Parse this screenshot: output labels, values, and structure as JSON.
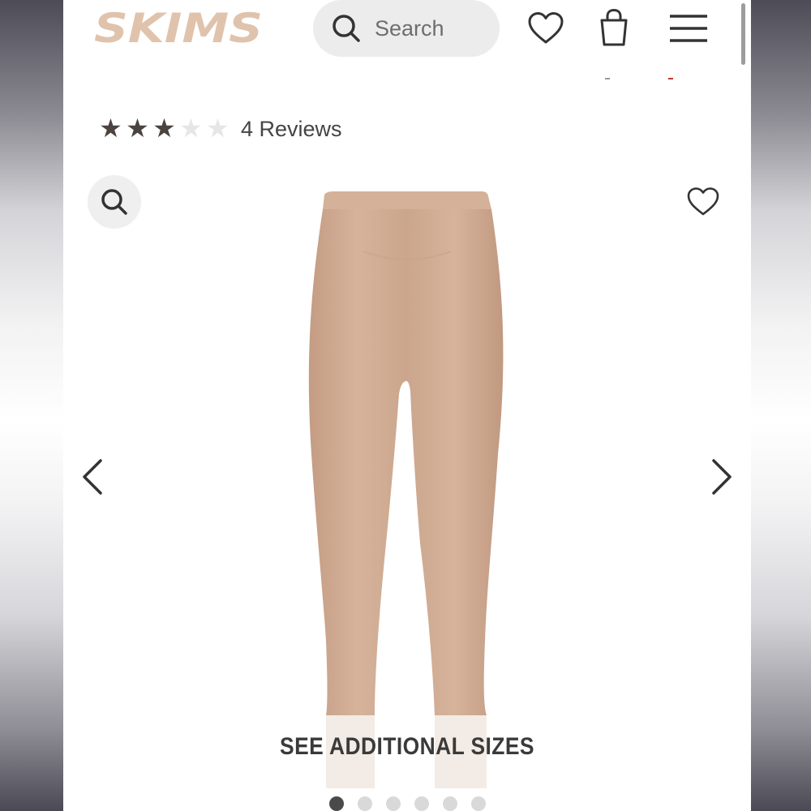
{
  "header": {
    "logo_text": "SKIMS",
    "search_placeholder": "Search",
    "wishlist_icon": "heart-icon",
    "bag_icon": "shopping-bag-icon",
    "menu_icon": "hamburger-menu-icon"
  },
  "rating": {
    "stars_filled": 3,
    "stars_total": 5,
    "reviews_label": "4 Reviews"
  },
  "gallery": {
    "zoom_icon": "magnifier-icon",
    "wishlist_icon": "heart-outline-icon",
    "prev_icon": "chevron-left-icon",
    "next_icon": "chevron-right-icon",
    "see_sizes_label": "SEE ADDITIONAL SIZES",
    "slide_count": 6,
    "active_slide": 1
  },
  "colors": {
    "brand_logo": "#E0C3AC",
    "product_tone": "#D0AA91",
    "icon_dark": "#333333",
    "star_filled": "#4A4340",
    "star_empty": "#E6E6E6"
  }
}
